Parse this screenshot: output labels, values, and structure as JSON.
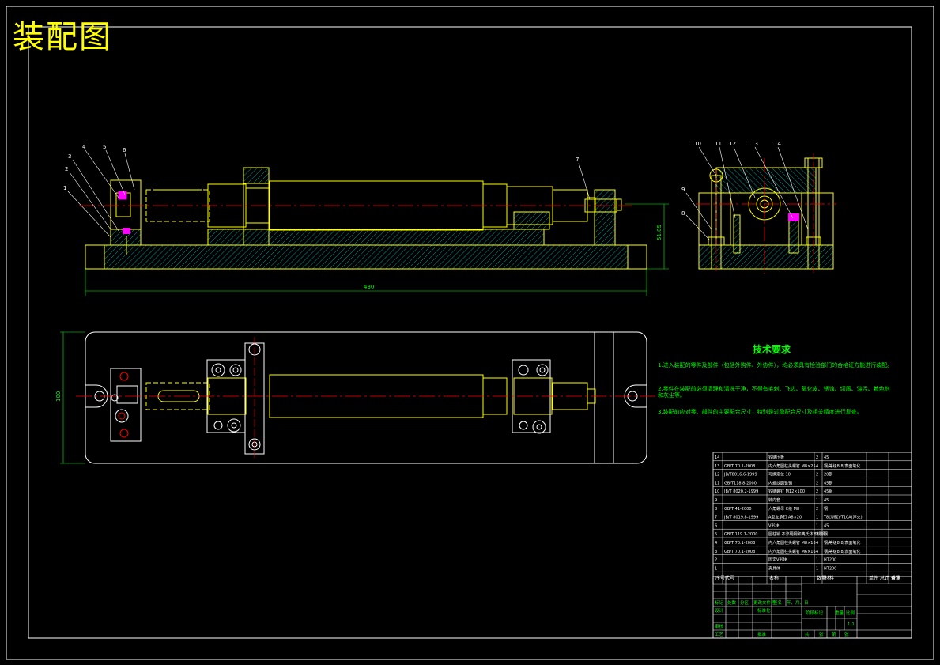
{
  "drawing": {
    "title": "装配图",
    "colors": {
      "background": "#000000",
      "border": "#ffffff",
      "outline": "#ffff00",
      "section": "#00ffff",
      "centerline": "#ff0000",
      "dimension": "#00ff00",
      "annotation": "#ffffff",
      "leader": "#ffffff"
    }
  },
  "front_view": {
    "balloons": [
      "1",
      "2",
      "3",
      "4",
      "5",
      "6",
      "7"
    ],
    "dims": {
      "overall_length": "430",
      "height": "51.05"
    }
  },
  "side_view": {
    "balloons": [
      "8",
      "9",
      "10",
      "11",
      "12",
      "13",
      "14"
    ]
  },
  "top_view": {
    "dims": {
      "width": "100"
    }
  },
  "tech_requirements": {
    "title": "技术要求",
    "items": [
      "1.进入装配的零件及部件（包括外购件、外协件），均必须具有检验部门的合格证方能进行装配。",
      "2.零件在装配前必须清理和清洗干净，不得有毛刺、飞边、氧化皮、锈蚀、切屑、油污、着色剂和灰尘等。",
      "3.装配前应对零、部件的主要配合尺寸，特别是过盈配合尺寸及相关精度进行复查。"
    ]
  },
  "bom": {
    "headers": [
      "序号",
      "代号",
      "名称",
      "数量",
      "材料",
      "单件 总计 重量",
      "备注"
    ],
    "rows": [
      [
        "14",
        "",
        "铰链压板",
        "2",
        "45",
        "",
        ""
      ],
      [
        "13",
        "GB/T 70.1-2008",
        "内六角圆柱头螺钉 M8×25",
        "4",
        "钢/等级8.8/表面氧化",
        "",
        ""
      ],
      [
        "12",
        "JB/T8016.6-1999",
        "可换定位 10",
        "2",
        "20钢",
        "",
        ""
      ],
      [
        "11",
        "GB/T118.8-2000",
        "内螺纹圆锥销",
        "2",
        "45钢",
        "",
        ""
      ],
      [
        "10",
        "JB/T 8020.2-1999",
        "铰链螺钉 M12×100",
        "2",
        "45钢",
        "",
        ""
      ],
      [
        "9",
        "",
        "转向套",
        "1",
        "45",
        "",
        ""
      ],
      [
        "8",
        "GB/T 41-2000",
        "六角螺母 C级 M8",
        "2",
        "钢",
        "",
        ""
      ],
      [
        "7",
        "JB/T 8019.8-1999",
        "A型支承钉 A8×20",
        "1",
        "T8(渗碳)/T10A(淬火)",
        "",
        ""
      ],
      [
        "6",
        "",
        "V形块",
        "1",
        "45",
        "",
        ""
      ],
      [
        "5",
        "GB/T 119.1-2000",
        "圆柱销 不淬硬钢和奥氏体不锈钢",
        "2",
        "钢",
        "",
        ""
      ],
      [
        "4",
        "GB/T 70.1-2008",
        "内六角圆柱头螺钉 M8×16",
        "4",
        "钢/等级8.8/表面氧化",
        "",
        ""
      ],
      [
        "3",
        "GB/T 70.1-2008",
        "内六角圆柱头螺钉 M6×16",
        "4",
        "钢/等级8.8/表面氧化",
        "",
        ""
      ],
      [
        "2",
        "",
        "固定V形块",
        "1",
        "HT200",
        "",
        ""
      ],
      [
        "1",
        "",
        "夹具体",
        "1",
        "HT200",
        "",
        ""
      ]
    ]
  },
  "title_block": {
    "change_row": [
      "标记",
      "处数",
      "分区",
      "更改文件号",
      "签名",
      "年、月、日"
    ],
    "left_labels": [
      "设计",
      "审核",
      "工艺"
    ],
    "std_label": "标准化",
    "approve_label": "批准",
    "stage_headers": [
      "阶段标记",
      "重量",
      "比例"
    ],
    "scale": "1:1",
    "sheet_row": [
      "共",
      "张",
      "第",
      "张"
    ]
  }
}
